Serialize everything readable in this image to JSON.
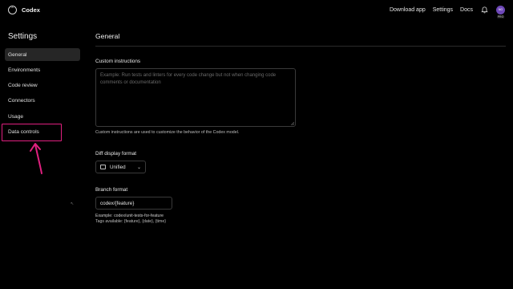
{
  "app": {
    "title": "Codex"
  },
  "topnav": {
    "links": [
      "Download app",
      "Settings",
      "Docs"
    ],
    "avatar_initials": "NG",
    "badge": "PRO"
  },
  "sidebar": {
    "title": "Settings",
    "items": [
      {
        "label": "General",
        "active": true
      },
      {
        "label": "Environments",
        "active": false
      },
      {
        "label": "Code review",
        "active": false
      },
      {
        "label": "Connectors",
        "active": false
      },
      {
        "label": "Usage",
        "active": false
      },
      {
        "label": "Data controls",
        "active": false
      }
    ]
  },
  "main": {
    "title": "General",
    "custom_instructions": {
      "label": "Custom instructions",
      "placeholder": "Example: Run tests and linters for every code change but not when changing code comments or documentation",
      "help": "Custom instructions are used to customize the behavior of the Codex model."
    },
    "diff_display": {
      "label": "Diff display format",
      "value": "Unified"
    },
    "branch_format": {
      "label": "Branch format",
      "value": "codex/{feature}",
      "example": "Example: codex/unit-tests-for-feature",
      "tags": "Tags available: {feature}, {date}, {time}"
    }
  },
  "annotation": {
    "color": "#e0207f"
  }
}
